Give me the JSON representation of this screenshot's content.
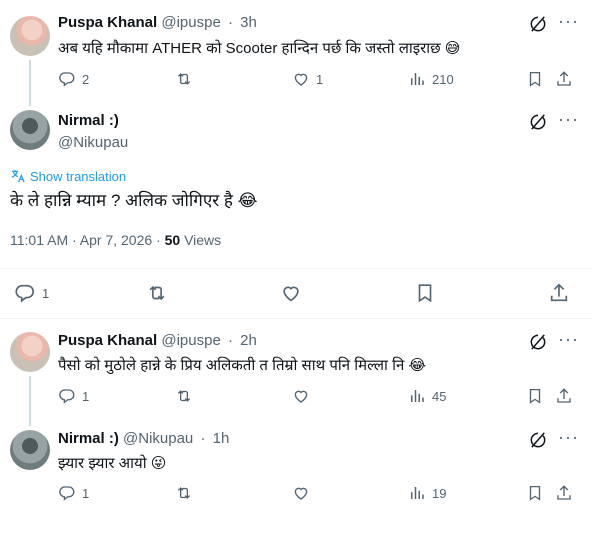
{
  "posts": [
    {
      "author": "Puspa Khanal",
      "handle": "@ipuspe",
      "time": "3h",
      "text": "अब यहि मौकामा ATHER को Scooter हान्दिन पर्छ कि जस्तो लाइराछ 😅",
      "replies": "2",
      "likes": "1",
      "views": "210"
    },
    {
      "author": "Nirmal :)",
      "handle": "@Nikupau",
      "show_translation": "Show translation",
      "text": "के ले हान्नि म्याम ?  अलिक जोगिएर है 😂",
      "time_full": "11:01 AM · Apr 7, 2026 · ",
      "views_count": "50",
      "views_label": " Views",
      "replies": "1"
    },
    {
      "author": "Puspa Khanal",
      "handle": "@ipuspe",
      "time": "2h",
      "text": "पैसो को मुठोले हान्ने के प्रिय अलिकती त तिम्रो साथ पनि मिल्ला नि 😂",
      "replies": "1",
      "views": "45"
    },
    {
      "author": "Nirmal :)",
      "handle": "@Nikupau",
      "time": "1h",
      "text": "झ्यार झ्यार आयो 😜",
      "replies": "1",
      "views": "19"
    }
  ],
  "icons": {
    "reply": "reply-icon",
    "retweet": "retweet-icon",
    "like": "like-icon",
    "views": "views-icon",
    "bookmark": "bookmark-icon",
    "share": "share-icon",
    "translate": "translate-icon",
    "more": "more-icon"
  },
  "colors": {
    "accent": "#1d9bf0",
    "muted": "#536471",
    "text": "#0f1419"
  }
}
